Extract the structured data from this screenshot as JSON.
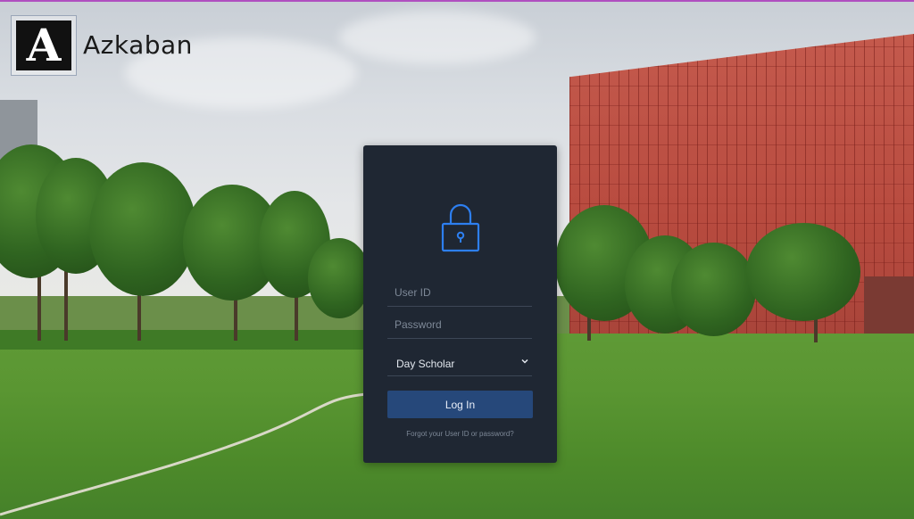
{
  "brand": {
    "logo_letter": "A",
    "name": "Azkaban"
  },
  "login": {
    "user_id_placeholder": "User ID",
    "password_placeholder": "Password",
    "role_selected": "Day Scholar",
    "submit_label": "Log In",
    "forgot_link": "Forgot your User ID or password?"
  },
  "colors": {
    "card_bg": "#1f2733",
    "accent_blue": "#2d7ff0",
    "button_bg": "#26487a",
    "top_strip": "#b04fc0"
  },
  "icons": {
    "lock": "lock-icon",
    "dropdown": "chevron-down-icon"
  }
}
